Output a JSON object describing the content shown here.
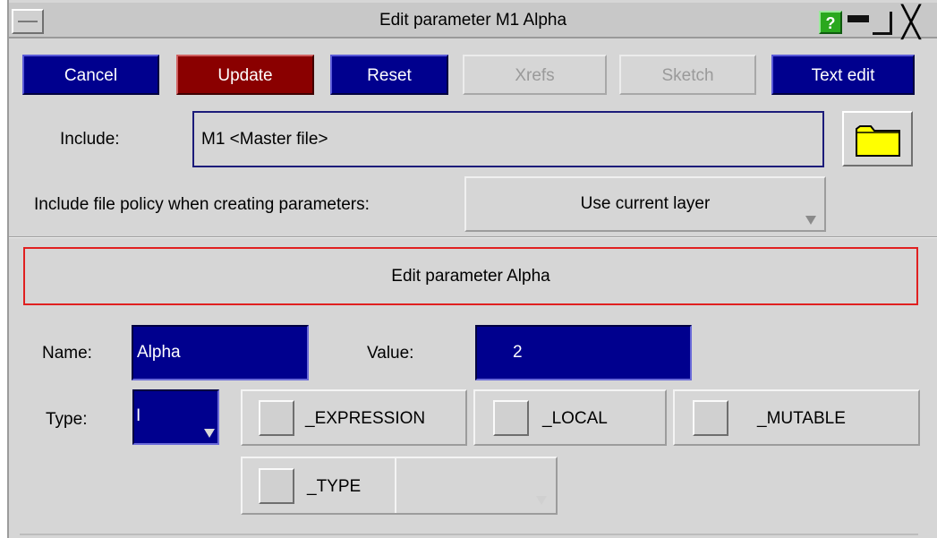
{
  "window": {
    "title": "Edit parameter M1 Alpha",
    "help_label": "?",
    "close_label": "╳"
  },
  "toolbar": {
    "cancel_label": "Cancel",
    "update_label": "Update",
    "reset_label": "Reset",
    "xrefs_label": "Xrefs",
    "sketch_label": "Sketch",
    "text_edit_label": "Text edit"
  },
  "include": {
    "label": "Include:",
    "value": "M1  <Master file>",
    "folder_icon": "folder-icon"
  },
  "policy": {
    "label": "Include file policy when creating parameters:",
    "value": "Use current layer"
  },
  "banner": {
    "text": "Edit parameter Alpha"
  },
  "fields": {
    "name_label": "Name:",
    "name_value": "Alpha",
    "value_label": "Value:",
    "value_value": "2",
    "type_label": "Type:",
    "type_value": "I"
  },
  "flags": {
    "expression_label": "_EXPRESSION",
    "local_label": "_LOCAL",
    "mutable_label": "_MUTABLE",
    "type_label": "_TYPE"
  },
  "colors": {
    "accent_blue": "#00008e",
    "accent_red": "#8a0000",
    "panel_grey": "#d6d6d6",
    "highlight_border": "#e02020"
  }
}
